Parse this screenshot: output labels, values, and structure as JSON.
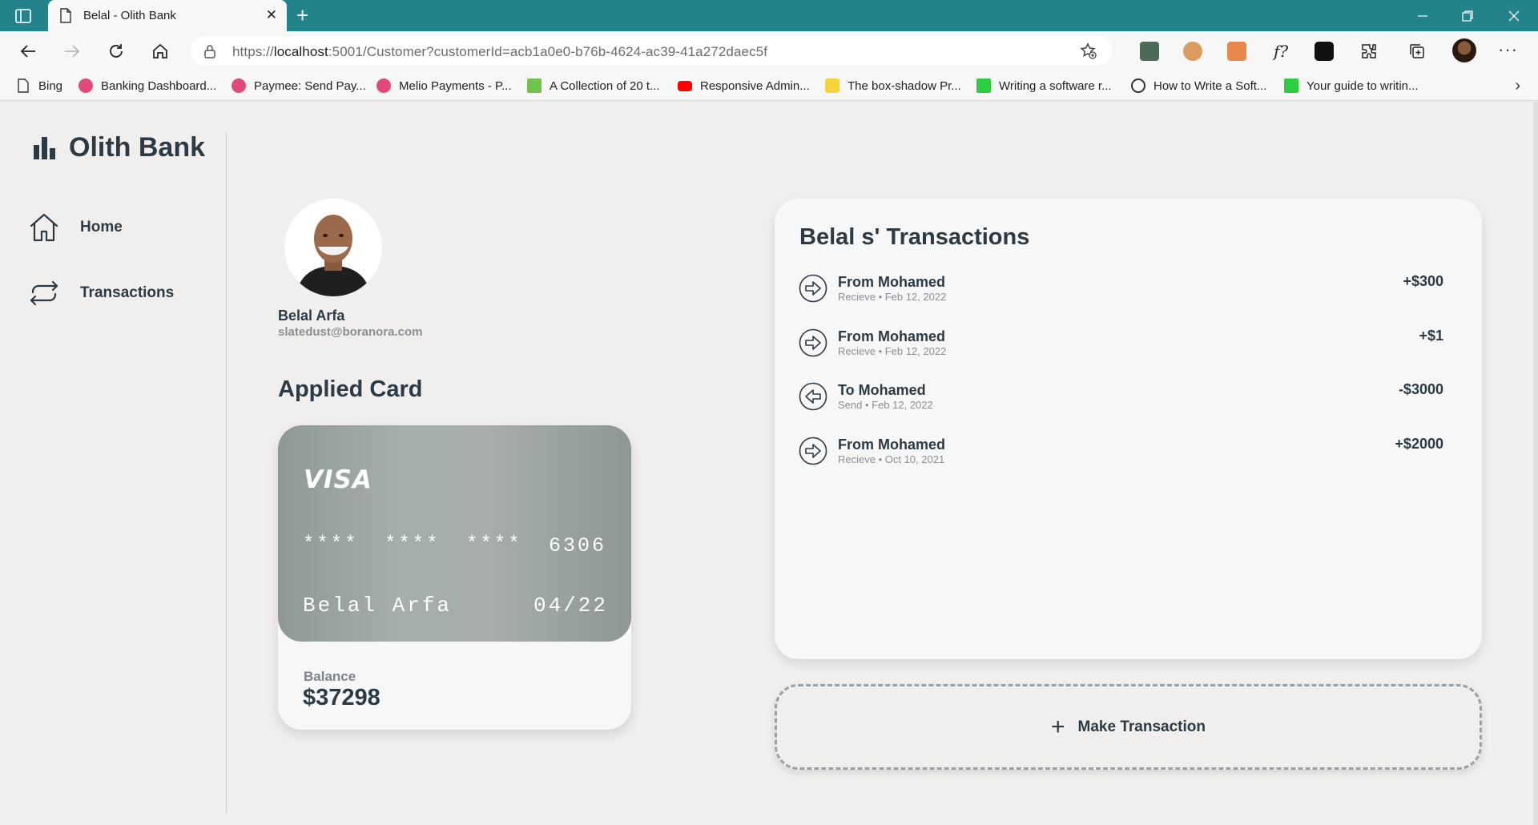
{
  "browser": {
    "tab_title": "Belal - Olith Bank",
    "url_prefix": "https://",
    "url_host": "localhost",
    "url_rest": ":5001/Customer?customerId=acb1a0e0-b76b-4624-ac39-41a272daec5f",
    "bookmarks": [
      {
        "label": "Bing",
        "icon": "page-icon"
      },
      {
        "label": "Banking Dashboard...",
        "icon": "dribbble-icon"
      },
      {
        "label": "Paymee: Send Pay...",
        "icon": "dribbble-icon"
      },
      {
        "label": "Melio Payments - P...",
        "icon": "dribbble-icon"
      },
      {
        "label": "A Collection of 20 t...",
        "icon": "green-site-icon"
      },
      {
        "label": "Responsive Admin...",
        "icon": "youtube-icon"
      },
      {
        "label": "The box-shadow Pr...",
        "icon": "yellow-site-icon"
      },
      {
        "label": "Writing a software r...",
        "icon": "medium-icon"
      },
      {
        "label": "How to Write a Soft...",
        "icon": "circle-site-icon"
      },
      {
        "label": "Your guide to writin...",
        "icon": "medium-icon"
      }
    ]
  },
  "sidebar": {
    "brand": "Olith Bank",
    "nav": [
      {
        "label": "Home",
        "icon": "home-icon"
      },
      {
        "label": "Transactions",
        "icon": "transactions-icon"
      }
    ]
  },
  "profile": {
    "name": "Belal Arfa",
    "email": "slatedust@boranora.com"
  },
  "card": {
    "section_title": "Applied Card",
    "brand": "VISA",
    "masked": [
      "****",
      "****",
      "****"
    ],
    "last4": "6306",
    "holder": "Belal Arfa",
    "expiry": "04/22",
    "balance_label": "Balance",
    "balance_value": "$37298"
  },
  "transactions": {
    "title": "Belal s' Transactions",
    "items": [
      {
        "name": "From Mohamed",
        "meta": "Recieve • Feb 12, 2022",
        "amount": "+$300",
        "direction": "in"
      },
      {
        "name": "From Mohamed",
        "meta": "Recieve • Feb 12, 2022",
        "amount": "+$1",
        "direction": "in"
      },
      {
        "name": "To Mohamed",
        "meta": "Send • Feb 12, 2022",
        "amount": "-$3000",
        "direction": "out"
      },
      {
        "name": "From Mohamed",
        "meta": "Recieve • Oct 10, 2021",
        "amount": "+$2000",
        "direction": "in"
      }
    ],
    "action_label": "Make Transaction"
  },
  "colors": {
    "titlebar": "#23838a",
    "text": "#2b3a45",
    "background": "#f1efed"
  }
}
